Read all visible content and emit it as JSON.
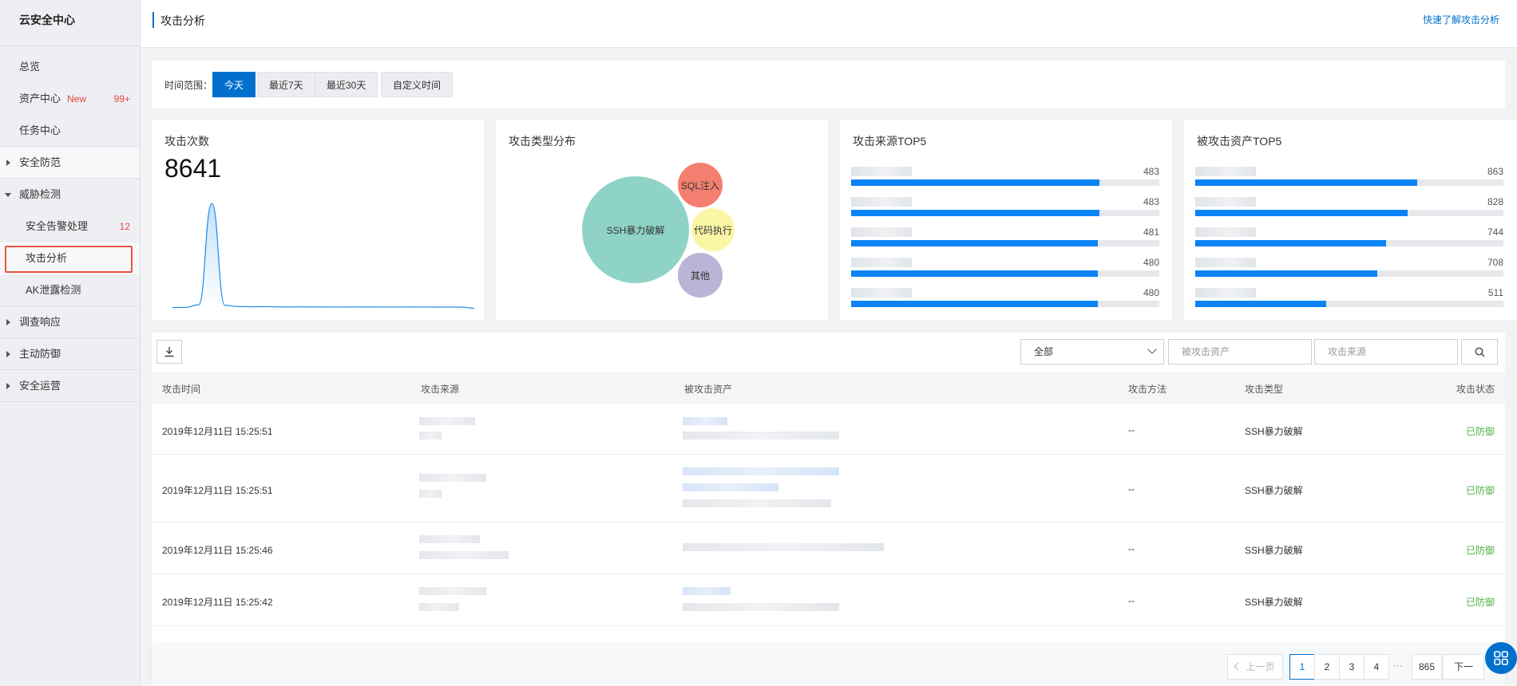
{
  "sidebar": {
    "title": "云安全中心",
    "items": [
      {
        "label": "总览"
      },
      {
        "label": "资产中心",
        "badge_new": "New",
        "count": "99+"
      },
      {
        "label": "任务中心"
      },
      {
        "label": "安全防范"
      },
      {
        "label": "威胁检测"
      },
      {
        "label": "安全告警处理",
        "count": "12"
      },
      {
        "label": "攻击分析"
      },
      {
        "label": "AK泄露检测"
      },
      {
        "label": "调查响应"
      },
      {
        "label": "主动防御"
      },
      {
        "label": "安全运营"
      }
    ]
  },
  "header": {
    "title": "攻击分析",
    "link": "快速了解攻击分析"
  },
  "time_range": {
    "label": "时间范围：",
    "options": [
      "今天",
      "最近7天",
      "最近30天",
      "自定义时间"
    ],
    "selected": "今天"
  },
  "cards": {
    "attack_count": {
      "title": "攻击次数",
      "value": "8641"
    },
    "type_dist": {
      "title": "攻击类型分布",
      "bubbles": [
        {
          "label": "SSH暴力破解",
          "color": "#8fd3c6"
        },
        {
          "label": "SQL注入",
          "color": "#f47f70"
        },
        {
          "label": "代码执行",
          "color": "#fbf6a6"
        },
        {
          "label": "其他",
          "color": "#bbb4d6"
        }
      ]
    },
    "source_top5": {
      "title": "攻击来源TOP5"
    },
    "asset_top5": {
      "title": "被攻击资产TOP5"
    }
  },
  "chart_data": [
    {
      "type": "line",
      "title": "攻击次数",
      "x": [
        0,
        1,
        2,
        3,
        4,
        5,
        6,
        7,
        8,
        9,
        10,
        11,
        12,
        13,
        14,
        15,
        16,
        17,
        18,
        19,
        20,
        21,
        22,
        23
      ],
      "values": [
        55,
        60,
        180,
        4840,
        160,
        100,
        90,
        95,
        85,
        80,
        85,
        80,
        78,
        75,
        80,
        78,
        76,
        75,
        78,
        76,
        74,
        75,
        72,
        20
      ]
    },
    {
      "type": "bar",
      "title": "攻击来源TOP5",
      "values": [
        483,
        483,
        481,
        480,
        480
      ],
      "xlim": [
        0,
        600
      ]
    },
    {
      "type": "bar",
      "title": "被攻击资产TOP5",
      "values": [
        863,
        828,
        744,
        708,
        511
      ],
      "xlim": [
        0,
        1200
      ]
    }
  ],
  "table": {
    "filter_select": "全部",
    "asset_placeholder": "被攻击资产",
    "source_placeholder": "攻击来源",
    "columns": [
      "攻击时间",
      "攻击来源",
      "被攻击资产",
      "攻击方法",
      "攻击类型",
      "攻击状态"
    ],
    "rows": [
      {
        "time": "2019年12月11日 15:25:51",
        "method": "--",
        "type": "SSH暴力破解",
        "status": "已防御"
      },
      {
        "time": "2019年12月11日 15:25:51",
        "method": "--",
        "type": "SSH暴力破解",
        "status": "已防御"
      },
      {
        "time": "2019年12月11日 15:25:46",
        "method": "--",
        "type": "SSH暴力破解",
        "status": "已防御"
      },
      {
        "time": "2019年12月11日 15:25:42",
        "method": "--",
        "type": "SSH暴力破解",
        "status": "已防御"
      }
    ]
  },
  "pagination": {
    "prev": "上一页",
    "pages": [
      "1",
      "2",
      "3",
      "4"
    ],
    "dots": "···",
    "last": "865",
    "next": "下一页",
    "current": "1"
  },
  "colors": {
    "accent": "#0070cc",
    "bar": "#0a84f5",
    "status_ok": "#52b346",
    "alert": "#e54545"
  }
}
